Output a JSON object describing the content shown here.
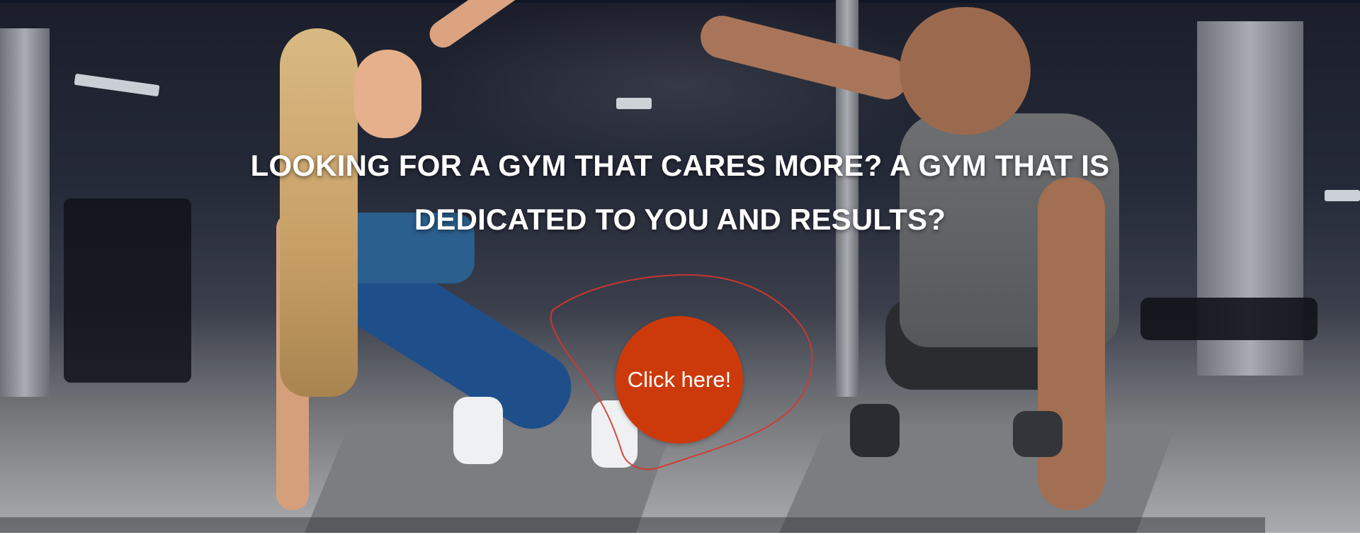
{
  "hero": {
    "headline": "LOOKING FOR A GYM THAT CARES MORE? A GYM THAT IS DEDICATED TO YOU AND RESULTS?",
    "cta_label": "Click here!",
    "cta_color": "#cc3a0b",
    "annotation_color": "#d8352e"
  }
}
